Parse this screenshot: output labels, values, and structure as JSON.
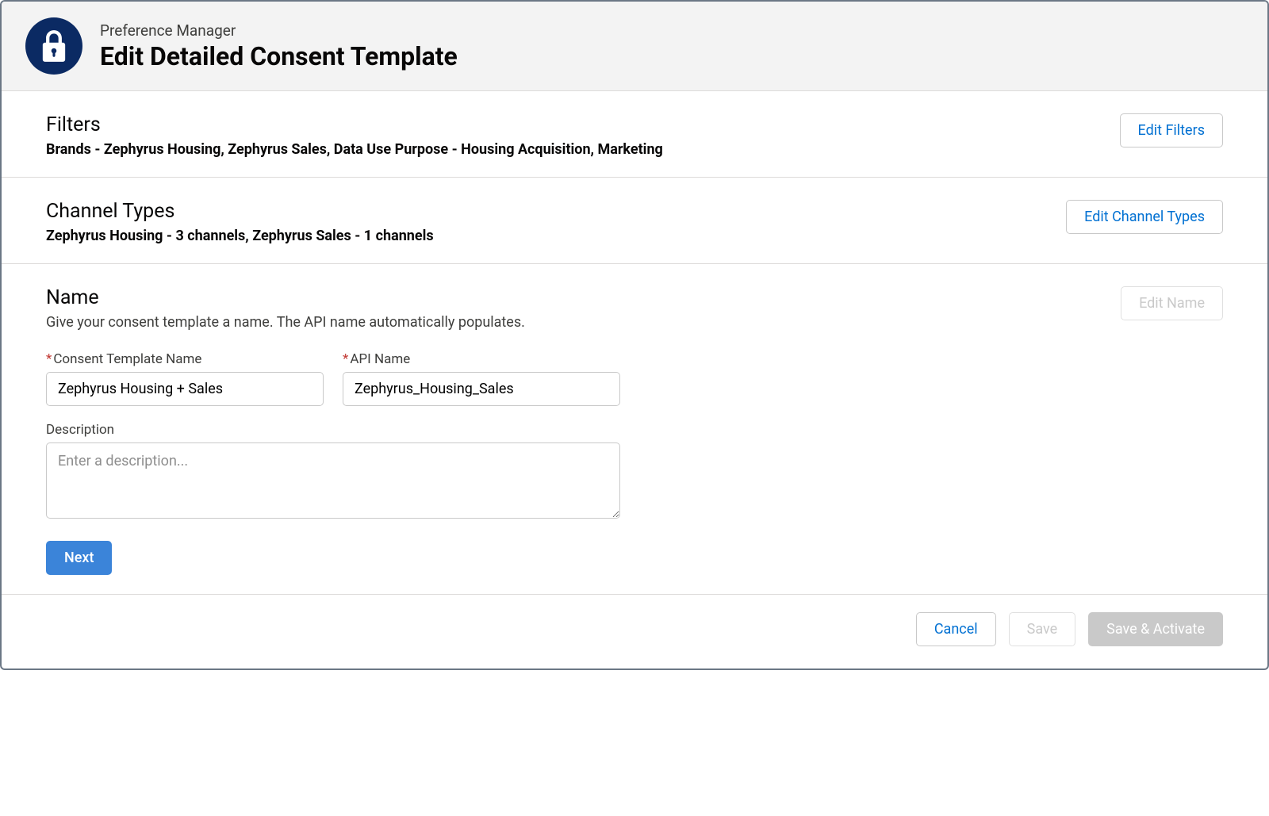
{
  "header": {
    "eyebrow": "Preference Manager",
    "title": "Edit Detailed Consent Template"
  },
  "filters": {
    "heading": "Filters",
    "summary": "Brands - Zephyrus Housing, Zephyrus Sales, Data Use Purpose - Housing Acquisition, Marketing",
    "edit_label": "Edit Filters"
  },
  "channel_types": {
    "heading": "Channel Types",
    "summary": "Zephyrus Housing - 3 channels, Zephyrus Sales - 1 channels",
    "edit_label": "Edit Channel Types"
  },
  "name_section": {
    "heading": "Name",
    "description": "Give your consent template a name. The API name automatically populates.",
    "edit_label": "Edit Name",
    "consent_template_name_label": "Consent Template Name",
    "consent_template_name_value": "Zephyrus Housing + Sales",
    "api_name_label": "API Name",
    "api_name_value": "Zephyrus_Housing_Sales",
    "description_label": "Description",
    "description_value": "",
    "description_placeholder": "Enter a description...",
    "next_label": "Next"
  },
  "footer": {
    "cancel_label": "Cancel",
    "save_label": "Save",
    "save_activate_label": "Save & Activate"
  }
}
